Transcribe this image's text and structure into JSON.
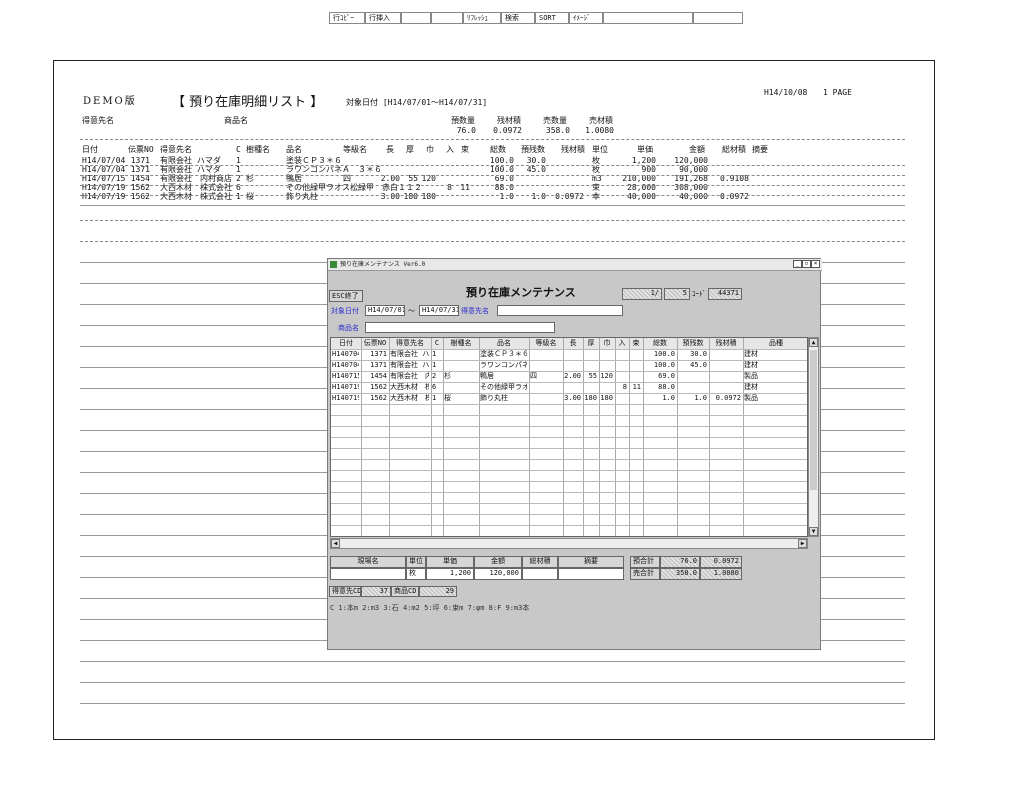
{
  "report": {
    "date": "H14/10/08",
    "page": "1 PAGE",
    "demo": "DEMO版",
    "title": "【 預り在庫明細リスト 】",
    "period": "対象日付 [H14/07/01〜H14/07/31]",
    "hdr_customer": "得意先名",
    "hdr_product": "商品名",
    "summary_labels": [
      "預数量",
      "残材積",
      "売数量",
      "売材積"
    ],
    "summary_values": [
      "76.0",
      "0.0972",
      "358.0",
      "1.0080"
    ],
    "columns": [
      "日付",
      "伝票NO",
      "得意先名",
      "C",
      "樹種名",
      "品名",
      "等級名",
      "長",
      "厚",
      "巾",
      "入",
      "束",
      "総数",
      "預残数",
      "残材積",
      "単位",
      "単価",
      "金額",
      "総材積",
      "摘要"
    ],
    "rows": [
      {
        "date": "H14/07/04",
        "no": "1371",
        "cust": "有限会社 ハマダ",
        "c": "1",
        "species": "",
        "item": "塗装ＣＰ３＊６",
        "grade": "",
        "len": "",
        "thk": "",
        "wid": "",
        "iri": "",
        "taba": "",
        "total": "100.0",
        "remain": "30.0",
        "vol": "",
        "unit": "枚",
        "price": "1,200",
        "amount": "120,000",
        "tvol": ""
      },
      {
        "date": "H14/07/04",
        "no": "1371",
        "cust": "有限会社 ハマダ",
        "c": "1",
        "species": "",
        "item": "ラワンコンパネＡ　３＊６",
        "grade": "",
        "len": "",
        "thk": "",
        "wid": "",
        "iri": "",
        "taba": "",
        "total": "100.0",
        "remain": "45.0",
        "vol": "",
        "unit": "枚",
        "price": "900",
        "amount": "90,000",
        "tvol": ""
      },
      {
        "date": "H14/07/15",
        "no": "1454",
        "cust": "有限会社　内村商店",
        "c": "2",
        "species": "杉",
        "item": "鴨居",
        "grade": "四",
        "len": "2.00",
        "thk": "55",
        "wid": "120",
        "iri": "",
        "taba": "",
        "total": "69.0",
        "remain": "",
        "vol": "",
        "unit": "m3",
        "price": "210,000",
        "amount": "191,268",
        "tvol": "0.9108"
      },
      {
        "date": "H14/07/19",
        "no": "1562",
        "cust": "大西木材　株式会社",
        "c": "6",
        "species": "",
        "item": "その他緑甲ラオス松緑甲　赤白１１２",
        "grade": "",
        "len": "",
        "thk": "",
        "wid": "",
        "iri": "8",
        "taba": "11",
        "total": "88.0",
        "remain": "",
        "vol": "",
        "unit": "束",
        "price": "28,000",
        "amount": "308,000",
        "tvol": ""
      },
      {
        "date": "H14/07/19",
        "no": "1562",
        "cust": "大西木材　株式会社",
        "c": "1",
        "species": "桜",
        "item": "飾り丸柱",
        "grade": "",
        "len": "3.00",
        "thk": "180",
        "wid": "180",
        "iri": "",
        "taba": "",
        "total": "1.0",
        "remain": "1.0",
        "vol": "0.0972",
        "unit": "本",
        "price": "40,000",
        "amount": "40,000",
        "tvol": "0.0972"
      }
    ]
  },
  "window": {
    "title": "預り在庫メンテナンス Ver6.0",
    "controls": {
      "min": "_",
      "max": "▫",
      "close": "×"
    },
    "toolbar": [
      "行ｺﾋﾟｰ",
      "行挿入",
      "",
      "",
      "ﾘﾌﾚｯｼｭ",
      "検索",
      "SORT",
      "ｲﾒｰｼﾞ",
      "",
      ""
    ],
    "esc_label": "ESC終了",
    "form_title": "預り在庫メンテナンス",
    "record_pos": "1/",
    "record_count": "5",
    "code_label": "ｺｰﾄﾞ",
    "code_value": "44371",
    "date_label": "対象日付",
    "date_from": "H14/07/01",
    "tilde": "〜",
    "date_to": "H14/07/31",
    "customer_label": "得意先名",
    "customer_value": "",
    "product_label": "商品名",
    "product_value": "",
    "grid_headers": [
      "日付",
      "伝票NO",
      "得意先名",
      "C",
      "樹種名",
      "品名",
      "等級名",
      "長",
      "厚",
      "巾",
      "入",
      "束",
      "総数",
      "預残数",
      "残材積",
      "品種"
    ],
    "grid_rows": [
      [
        "H140704",
        "1371",
        "有限会社 ハマダ",
        "1",
        "",
        "塗装ＣＰ３＊６",
        "",
        "",
        "",
        "",
        "",
        "",
        "100.0",
        "30.0",
        "",
        "建材"
      ],
      [
        "H140704",
        "1371",
        "有限会社 ハマダ",
        "1",
        "",
        "ラワンコンパネＡ　３＊６",
        "",
        "",
        "",
        "",
        "",
        "",
        "100.0",
        "45.0",
        "",
        "建材"
      ],
      [
        "H140715",
        "1454",
        "有限会社　内村商店",
        "2",
        "杉",
        "鴨居",
        "四",
        "2.00",
        "55",
        "120",
        "",
        "",
        "69.0",
        "",
        "",
        "製品"
      ],
      [
        "H140719",
        "1562",
        "大西木材　株式会社",
        "6",
        "",
        "その他緑甲ラオス松緑甲　赤白１１２",
        "",
        "",
        "",
        "",
        "8",
        "11",
        "88.0",
        "",
        "",
        "建材"
      ],
      [
        "H140719",
        "1562",
        "大西木材　株式会社",
        "1",
        "桜",
        "飾り丸柱",
        "",
        "3.00",
        "180",
        "180",
        "",
        "",
        "1.0",
        "1.0",
        "0.0972",
        "製品"
      ]
    ],
    "detail_headers": [
      "現場名",
      "単位",
      "単価",
      "金額",
      "総材積",
      "摘要"
    ],
    "detail_values": [
      "",
      "枚",
      "1,200",
      "120,000",
      "",
      ""
    ],
    "yotai_label": "預合計",
    "yotai_v1": "76.0",
    "yotai_v2": "0.0972",
    "urigo_label": "売合計",
    "urigo_v1": "358.0",
    "urigo_v2": "1.0080",
    "cust_cd_label": "得意先CD",
    "cust_cd": "37",
    "prod_cd_label": "商品CD",
    "prod_cd": "29",
    "legend": "C 1:本m 2:m3 3:石 4:m2 5:坪 6:束m 7:φm 8:F 9:m3本"
  }
}
